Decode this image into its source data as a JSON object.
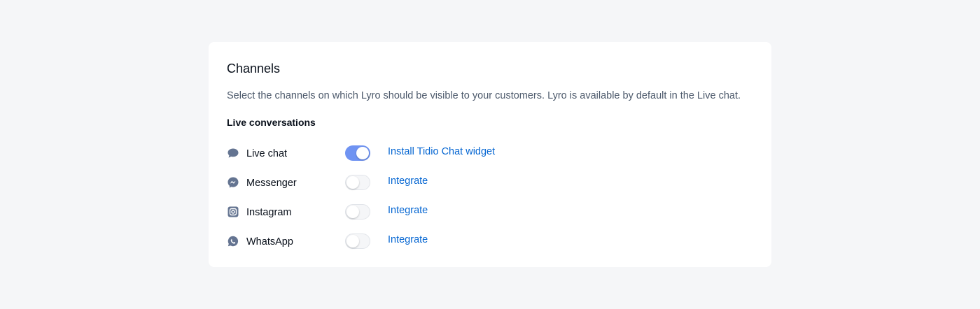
{
  "card": {
    "title": "Channels",
    "description": "Select the channels on which Lyro should be visible to your customers. Lyro is available by default in the Live chat.",
    "section_heading": "Live conversations"
  },
  "channels": [
    {
      "label": "Live chat",
      "icon": "chat-bubble-icon",
      "enabled": true,
      "action_label": "Install Tidio Chat widget"
    },
    {
      "label": "Messenger",
      "icon": "messenger-icon",
      "enabled": false,
      "action_label": "Integrate"
    },
    {
      "label": "Instagram",
      "icon": "instagram-icon",
      "enabled": false,
      "action_label": "Integrate"
    },
    {
      "label": "WhatsApp",
      "icon": "whatsapp-icon",
      "enabled": false,
      "action_label": "Integrate"
    }
  ],
  "colors": {
    "background": "#f5f6f8",
    "card": "#ffffff",
    "toggle_on": "#6f93f2",
    "link": "#0566d2",
    "icon": "#647491",
    "muted_text": "#4c596b"
  }
}
